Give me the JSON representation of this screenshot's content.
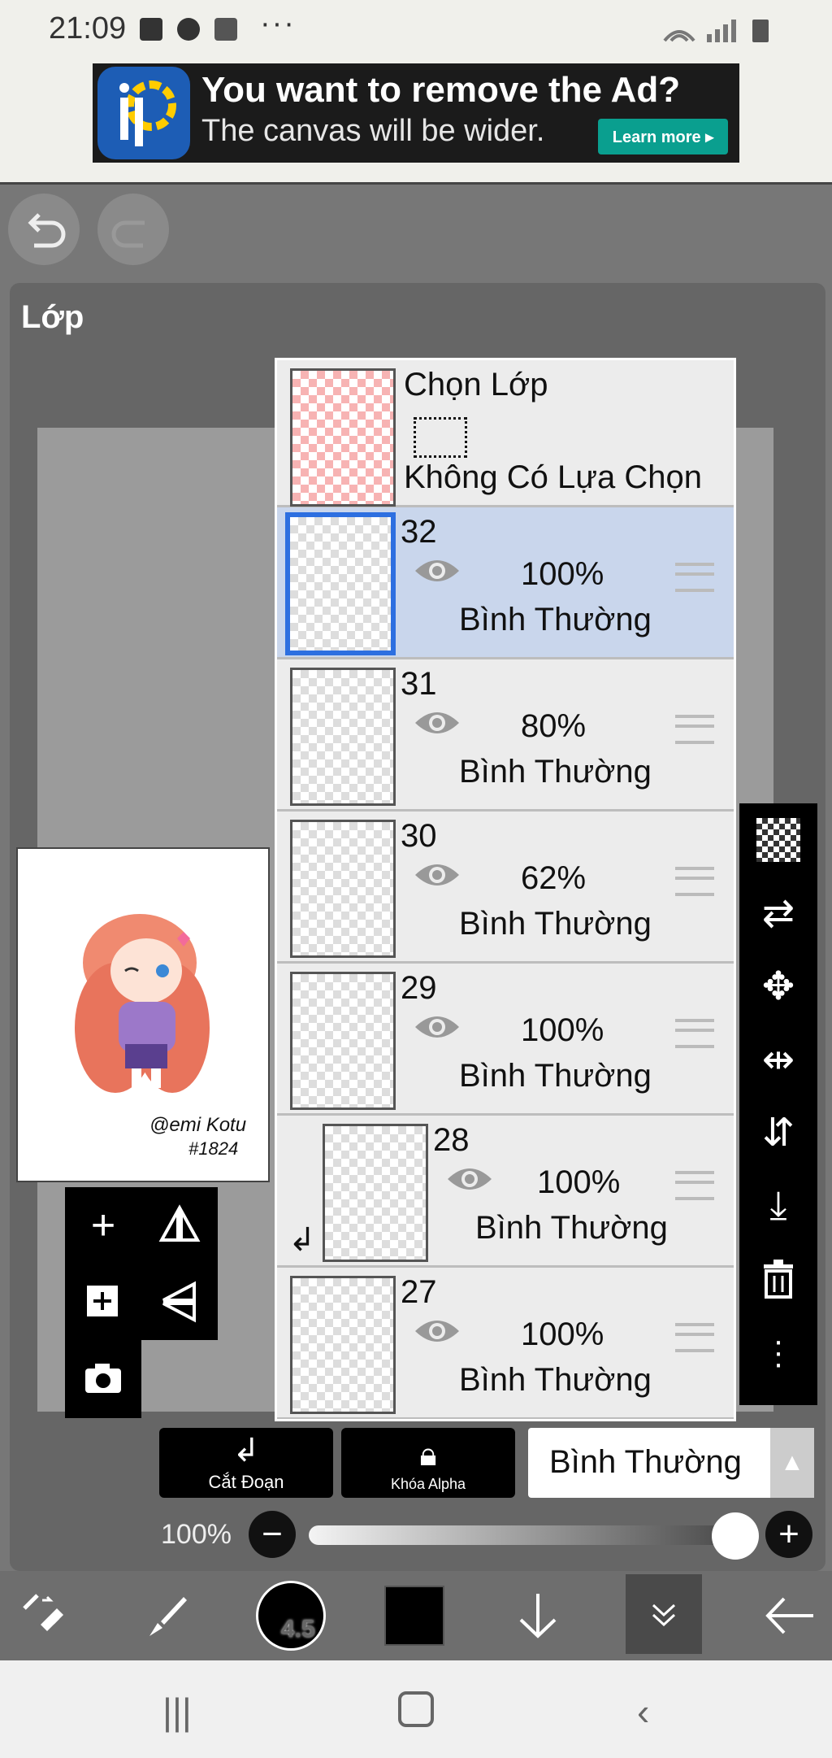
{
  "status_bar": {
    "time": "21:09",
    "more": "···"
  },
  "ad": {
    "headline": "You want to remove the Ad?",
    "subline": "The canvas will be wider.",
    "cta": "Learn more ▸"
  },
  "panel": {
    "title": "Lớp"
  },
  "selection_layer": {
    "title": "Chọn Lớp",
    "status": "Không Có Lựa Chọn"
  },
  "layers": [
    {
      "num": "32",
      "opacity": "100%",
      "mode": "Bình Thường",
      "selected": true
    },
    {
      "num": "31",
      "opacity": "80%",
      "mode": "Bình Thường",
      "selected": false
    },
    {
      "num": "30",
      "opacity": "62%",
      "mode": "Bình Thường",
      "selected": false
    },
    {
      "num": "29",
      "opacity": "100%",
      "mode": "Bình Thường",
      "selected": false
    },
    {
      "num": "28",
      "opacity": "100%",
      "mode": "Bình Thường",
      "selected": false,
      "clipped": true
    },
    {
      "num": "27",
      "opacity": "100%",
      "mode": "Bình Thường",
      "selected": false
    }
  ],
  "layer_actions": {
    "clip": "Cắt Đoạn",
    "alpha_lock": "Khóa Alpha"
  },
  "blend_mode": {
    "value": "Bình Thường"
  },
  "opacity": {
    "label": "100%",
    "value": 1.0
  },
  "brush": {
    "size": "4.5"
  },
  "colors": {
    "accent": "#2d6fe0",
    "selected_row": "#c9d6ec",
    "ad_cta": "#0a9f8f",
    "primary_color": "#000000"
  },
  "preview": {
    "signature": "@emi Kotu",
    "tag": "#1824"
  }
}
